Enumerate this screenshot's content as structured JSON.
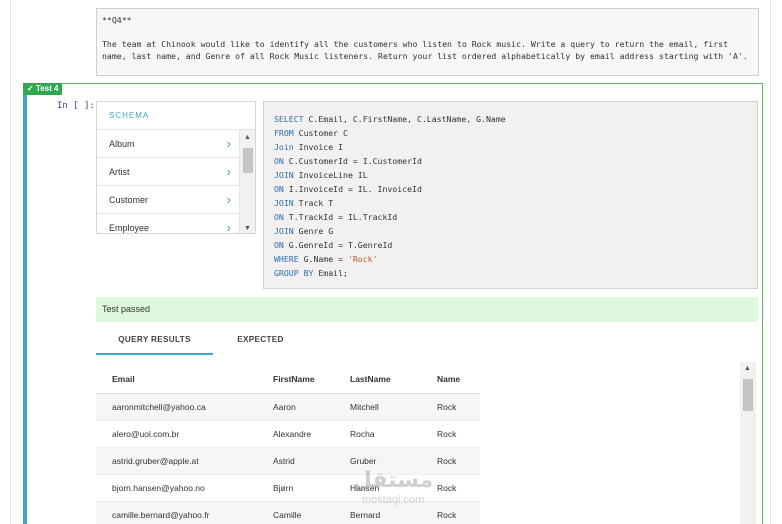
{
  "markdown": {
    "title": "**Q4**",
    "text": "The team at Chinook would like to identify all the customers who listen to Rock music. Write a query to return the email, first name, last name, and Genre of all Rock Music listeners. Return your list ordered alphabetically by email address starting with 'A'."
  },
  "test_cell": {
    "badge": "✓ Test 4",
    "prompt": "In [ ]:"
  },
  "schema": {
    "header": "SCHEMA",
    "items": [
      "Album",
      "Artist",
      "Customer",
      "Employee"
    ]
  },
  "code": {
    "lines": [
      [
        {
          "k": "SELECT"
        },
        {
          "t": " C.Email, C.FirstName, C.LastName, G.Name"
        }
      ],
      [
        {
          "k": "FROM"
        },
        {
          "t": " Customer C"
        }
      ],
      [
        {
          "k": "Join"
        },
        {
          "t": " Invoice I"
        }
      ],
      [
        {
          "k": "ON"
        },
        {
          "t": " C.CustomerId = I.CustomerId"
        }
      ],
      [
        {
          "k": "JOIN"
        },
        {
          "t": " InvoiceLine IL"
        }
      ],
      [
        {
          "k": "ON"
        },
        {
          "t": " I.InvoiceId = IL. InvoiceId"
        }
      ],
      [
        {
          "k": "JOIN"
        },
        {
          "t": " Track T"
        }
      ],
      [
        {
          "k": "ON"
        },
        {
          "t": " T.TrackId = IL.TrackId"
        }
      ],
      [
        {
          "k": "JOIN"
        },
        {
          "t": " Genre G"
        }
      ],
      [
        {
          "k": "ON"
        },
        {
          "t": " G.GenreId = T.GenreId"
        }
      ],
      [
        {
          "k": "WHERE"
        },
        {
          "t": " G.Name = "
        },
        {
          "s": "'Rock'"
        }
      ],
      [
        {
          "k": "GROUP BY"
        },
        {
          "t": " Email;"
        }
      ]
    ]
  },
  "status": "Test passed",
  "tabs": [
    "QUERY RESULTS",
    "EXPECTED"
  ],
  "results": {
    "headers": [
      "Email",
      "FirstName",
      "LastName",
      "Name"
    ],
    "rows": [
      [
        "aaronmitchell@yahoo.ca",
        "Aaron",
        "Mitchell",
        "Rock"
      ],
      [
        "alero@uol.com.br",
        "Alexandre",
        "Rocha",
        "Rock"
      ],
      [
        "astrid.gruber@apple.at",
        "Astrid",
        "Gruber",
        "Rock"
      ],
      [
        "bjorn.hansen@yahoo.no",
        "Bjørn",
        "Hansen",
        "Rock"
      ],
      [
        "camille.bernard@yahoo.fr",
        "Camille",
        "Bernard",
        "Rock"
      ]
    ]
  },
  "watermark": {
    "arabic": "مستقل",
    "latin": "mostaql.com"
  },
  "colors": {
    "accent": "#42a5c6",
    "pass": "#2fa84f",
    "passed_bg": "#dff9df"
  }
}
